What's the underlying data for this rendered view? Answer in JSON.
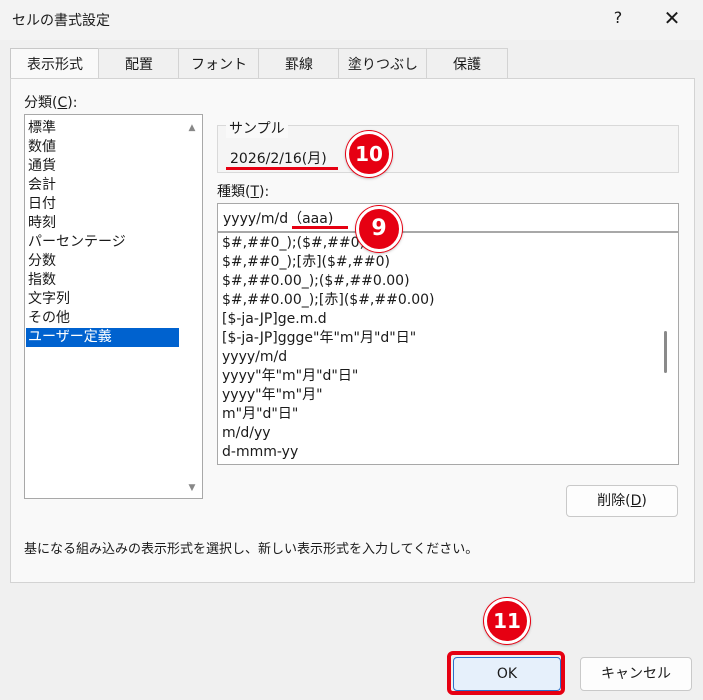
{
  "window": {
    "title": "セルの書式設定",
    "help": "?",
    "close": "✕"
  },
  "tabs": [
    "表示形式",
    "配置",
    "フォント",
    "罫線",
    "塗りつぶし",
    "保護"
  ],
  "category": {
    "label_prefix": "分類(",
    "label_key": "C",
    "label_suffix": "):",
    "items": [
      "標準",
      "数値",
      "通貨",
      "会計",
      "日付",
      "時刻",
      "パーセンテージ",
      "分数",
      "指数",
      "文字列",
      "その他",
      "ユーザー定義"
    ],
    "selected_index": 11
  },
  "sample": {
    "label": "サンプル",
    "value": "2026/2/16(月)"
  },
  "type_field": {
    "label_prefix": "種類(",
    "label_key": "T",
    "label_suffix": "):",
    "value": "yyyy/m/d（aaa)"
  },
  "format_list": [
    "$#,##0_);($#,##0)",
    "$#,##0_);[赤]($#,##0)",
    "$#,##0.00_);($#,##0.00)",
    "$#,##0.00_);[赤]($#,##0.00)",
    "[$-ja-JP]ge.m.d",
    "[$-ja-JP]ggge\"年\"m\"月\"d\"日\"",
    "yyyy/m/d",
    "yyyy\"年\"m\"月\"d\"日\"",
    "yyyy\"年\"m\"月\"",
    "m\"月\"d\"日\"",
    "m/d/yy",
    "d-mmm-yy"
  ],
  "delete_button": {
    "prefix": "削除(",
    "key": "D",
    "suffix": ")"
  },
  "description": "基になる組み込みの表示形式を選択し、新しい表示形式を入力してください。",
  "ok_button": "OK",
  "cancel_button": "キャンセル",
  "annotations": {
    "n9": "9",
    "n10": "10",
    "n11": "11"
  },
  "colors": {
    "accent": "#0062cf",
    "highlight": "#e60012"
  }
}
